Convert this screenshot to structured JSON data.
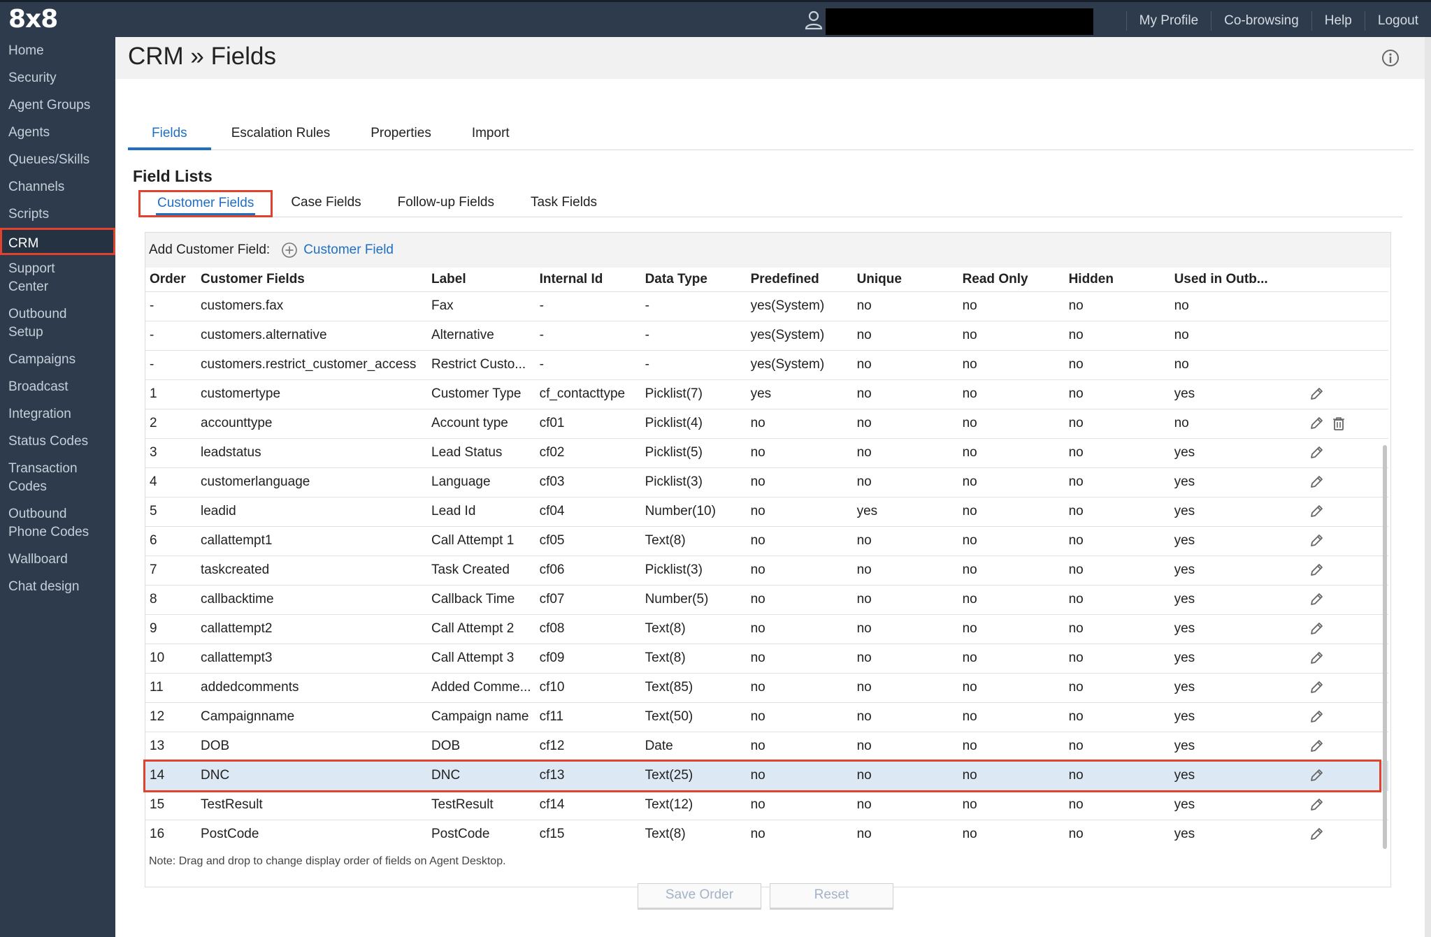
{
  "app": {
    "logo": "8x8",
    "top_links": [
      "My Profile",
      "Co-browsing",
      "Help",
      "Logout"
    ],
    "icons": {
      "user": "user-icon",
      "info": "info-icon",
      "add": "plus-circle-icon",
      "edit": "pencil-icon",
      "delete": "trash-icon"
    }
  },
  "sidebar": {
    "items": [
      {
        "label": "Home"
      },
      {
        "label": "Security"
      },
      {
        "label": "Agent Groups"
      },
      {
        "label": "Agents"
      },
      {
        "label": "Queues/Skills"
      },
      {
        "label": "Channels"
      },
      {
        "label": "Scripts"
      },
      {
        "label": "CRM",
        "active": true
      },
      {
        "label": "Support Center"
      },
      {
        "label": "Outbound Setup"
      },
      {
        "label": "Campaigns"
      },
      {
        "label": "Broadcast"
      },
      {
        "label": "Integration"
      },
      {
        "label": "Status Codes"
      },
      {
        "label": "Transaction Codes"
      },
      {
        "label": "Outbound Phone Codes"
      },
      {
        "label": "Wallboard"
      },
      {
        "label": "Chat design"
      }
    ]
  },
  "page": {
    "title": "CRM » Fields"
  },
  "tabs": [
    "Fields",
    "Escalation Rules",
    "Properties",
    "Import"
  ],
  "field_lists": {
    "title": "Field Lists",
    "tabs": [
      "Customer Fields",
      "Case Fields",
      "Follow-up Fields",
      "Task Fields"
    ]
  },
  "add_field": {
    "label": "Add Customer Field:",
    "button": "Customer Field"
  },
  "table": {
    "headers": [
      "Order",
      "Customer Fields",
      "Label",
      "Internal Id",
      "Data Type",
      "Predefined",
      "Unique",
      "Read Only",
      "Hidden",
      "Used in Outb..."
    ],
    "rows": [
      {
        "cells": [
          "-",
          "customers.fax",
          "Fax",
          "-",
          "-",
          "yes(System)",
          "no",
          "no",
          "no",
          "no"
        ],
        "edit": false,
        "delete": false
      },
      {
        "cells": [
          "-",
          "customers.alternative",
          "Alternative",
          "-",
          "-",
          "yes(System)",
          "no",
          "no",
          "no",
          "no"
        ],
        "edit": false,
        "delete": false
      },
      {
        "cells": [
          "-",
          "customers.restrict_customer_access",
          "Restrict Custo...",
          "-",
          "-",
          "yes(System)",
          "no",
          "no",
          "no",
          "no"
        ],
        "edit": false,
        "delete": false
      },
      {
        "cells": [
          "1",
          "customertype",
          "Customer Type",
          "cf_contacttype",
          "Picklist(7)",
          "yes",
          "no",
          "no",
          "no",
          "yes"
        ],
        "edit": true,
        "delete": false
      },
      {
        "cells": [
          "2",
          "accounttype",
          "Account type",
          "cf01",
          "Picklist(4)",
          "no",
          "no",
          "no",
          "no",
          "no"
        ],
        "edit": true,
        "delete": true
      },
      {
        "cells": [
          "3",
          "leadstatus",
          "Lead Status",
          "cf02",
          "Picklist(5)",
          "no",
          "no",
          "no",
          "no",
          "yes"
        ],
        "edit": true,
        "delete": false
      },
      {
        "cells": [
          "4",
          "customerlanguage",
          "Language",
          "cf03",
          "Picklist(3)",
          "no",
          "no",
          "no",
          "no",
          "yes"
        ],
        "edit": true,
        "delete": false
      },
      {
        "cells": [
          "5",
          "leadid",
          "Lead Id",
          "cf04",
          "Number(10)",
          "no",
          "yes",
          "no",
          "no",
          "yes"
        ],
        "edit": true,
        "delete": false
      },
      {
        "cells": [
          "6",
          "callattempt1",
          "Call Attempt 1",
          "cf05",
          "Text(8)",
          "no",
          "no",
          "no",
          "no",
          "yes"
        ],
        "edit": true,
        "delete": false
      },
      {
        "cells": [
          "7",
          "taskcreated",
          "Task Created",
          "cf06",
          "Picklist(3)",
          "no",
          "no",
          "no",
          "no",
          "yes"
        ],
        "edit": true,
        "delete": false
      },
      {
        "cells": [
          "8",
          "callbacktime",
          "Callback Time",
          "cf07",
          "Number(5)",
          "no",
          "no",
          "no",
          "no",
          "yes"
        ],
        "edit": true,
        "delete": false
      },
      {
        "cells": [
          "9",
          "callattempt2",
          "Call Attempt 2",
          "cf08",
          "Text(8)",
          "no",
          "no",
          "no",
          "no",
          "yes"
        ],
        "edit": true,
        "delete": false
      },
      {
        "cells": [
          "10",
          "callattempt3",
          "Call Attempt 3",
          "cf09",
          "Text(8)",
          "no",
          "no",
          "no",
          "no",
          "yes"
        ],
        "edit": true,
        "delete": false
      },
      {
        "cells": [
          "11",
          "addedcomments",
          "Added Comme...",
          "cf10",
          "Text(85)",
          "no",
          "no",
          "no",
          "no",
          "yes"
        ],
        "edit": true,
        "delete": false
      },
      {
        "cells": [
          "12",
          "Campaignname",
          "Campaign name",
          "cf11",
          "Text(50)",
          "no",
          "no",
          "no",
          "no",
          "yes"
        ],
        "edit": true,
        "delete": false
      },
      {
        "cells": [
          "13",
          "DOB",
          "DOB",
          "cf12",
          "Date",
          "no",
          "no",
          "no",
          "no",
          "yes"
        ],
        "edit": true,
        "delete": false
      },
      {
        "cells": [
          "14",
          "DNC",
          "DNC",
          "cf13",
          "Text(25)",
          "no",
          "no",
          "no",
          "no",
          "yes"
        ],
        "edit": true,
        "delete": false,
        "highlighted": true
      },
      {
        "cells": [
          "15",
          "TestResult",
          "TestResult",
          "cf14",
          "Text(12)",
          "no",
          "no",
          "no",
          "no",
          "yes"
        ],
        "edit": true,
        "delete": false
      },
      {
        "cells": [
          "16",
          "PostCode",
          "PostCode",
          "cf15",
          "Text(8)",
          "no",
          "no",
          "no",
          "no",
          "yes"
        ],
        "edit": true,
        "delete": false
      }
    ]
  },
  "note": "Note: Drag and drop to change display order of fields on Agent Desktop.",
  "buttons": {
    "save": "Save Order",
    "reset": "Reset"
  },
  "colors": {
    "sidebar_bg": "#2d3b4c",
    "accent": "#1f6fc5",
    "highlight_frame": "#e0432d",
    "selected_row": "#dde8f5"
  }
}
